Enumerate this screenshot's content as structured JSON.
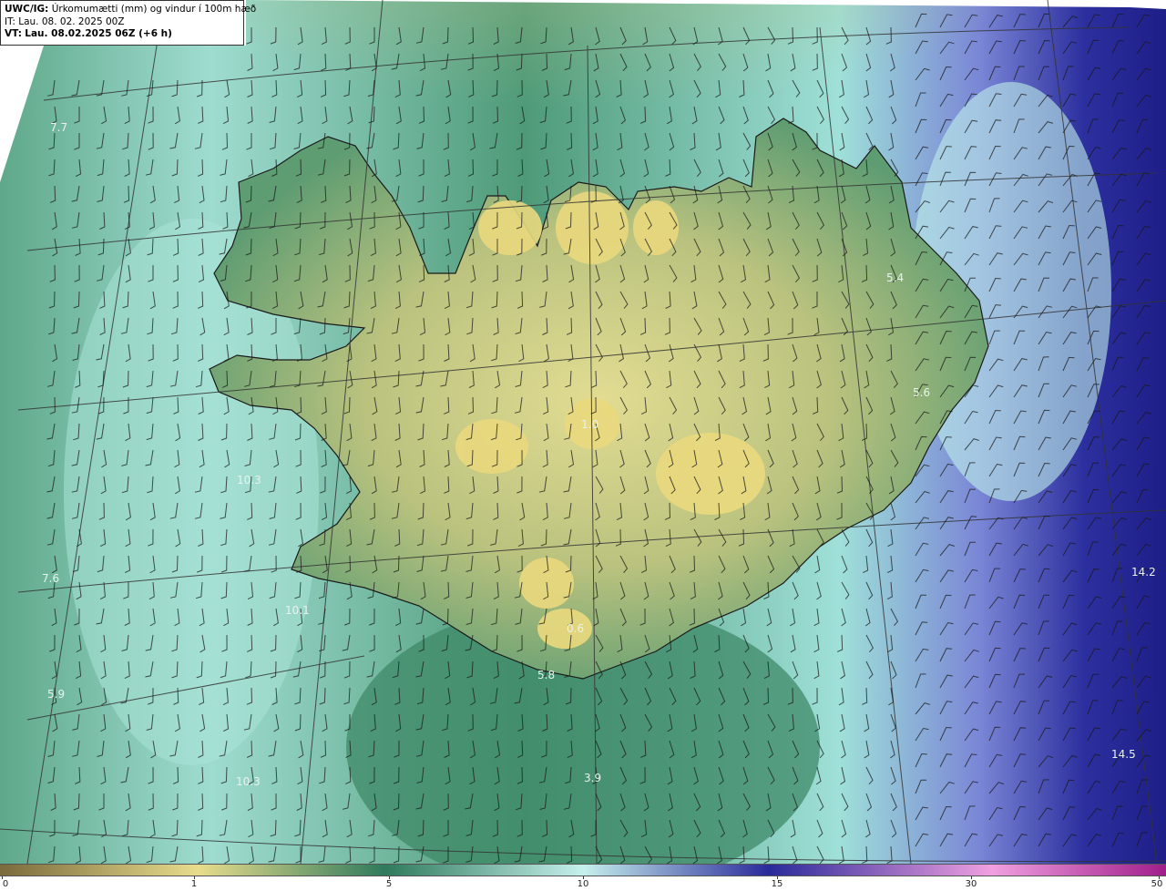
{
  "header": {
    "product": "UWC/IG:",
    "description": "Úrkomumætti (mm) og vindur í 100m hæð",
    "it_label": "IT: Lau. 08. 02. 2025 00Z",
    "vt_prefix": "VT:",
    "vt_label": "Lau. 08.02.2025 06Z (+6 h)"
  },
  "map_values": [
    {
      "text": "7.7"
    },
    {
      "text": "5.4"
    },
    {
      "text": "5.6"
    },
    {
      "text": "7.6"
    },
    {
      "text": "14.2"
    },
    {
      "text": "5.8"
    },
    {
      "text": "14.5"
    },
    {
      "text": "3.9"
    },
    {
      "text": "10.3"
    },
    {
      "text": "10.1"
    },
    {
      "text": "10.3"
    },
    {
      "text": "1.0"
    },
    {
      "text": "0.6"
    },
    {
      "text": "5.9"
    }
  ],
  "colorbar": {
    "ticks": [
      {
        "label": "0",
        "value": 0
      },
      {
        "label": "1",
        "value": 1
      },
      {
        "label": "5",
        "value": 5
      },
      {
        "label": "10",
        "value": 10
      },
      {
        "label": "15",
        "value": 15
      },
      {
        "label": "30",
        "value": 30
      },
      {
        "label": "50",
        "value": 50
      }
    ],
    "colors": {
      "dry": "#7a6a3c",
      "low": "#e8dc8c",
      "mid": "#2f7a5c",
      "high": "#c6f0ec",
      "heavy": "#2a2a9a",
      "extreme": "#f0a0e0",
      "max": "#a01e8a"
    }
  },
  "colors": {
    "land_yellow": "#d8d38a",
    "sea_green": "#4e9a78",
    "sea_teal": "#8fd3c6",
    "heavy_blue": "#2b2f9c",
    "coast_line": "#1a1a1a",
    "grid_line": "#333333"
  }
}
